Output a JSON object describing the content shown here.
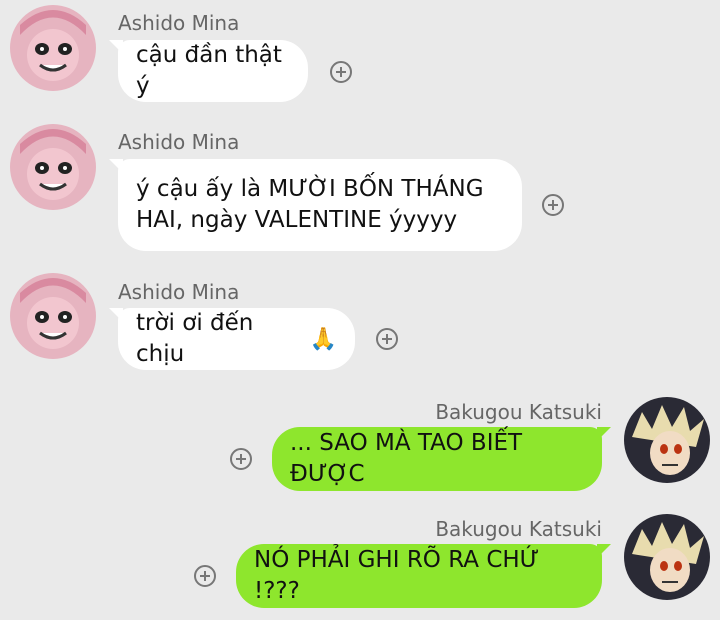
{
  "messages": [
    {
      "sender": "Ashido Mina",
      "text": "cậu đần thật ý",
      "direction": "incoming"
    },
    {
      "sender": "Ashido Mina",
      "text": "ý cậu ấy là MƯỜI BỐN THÁNG HAI, ngày VALENTINE ýyyyy",
      "direction": "incoming"
    },
    {
      "sender": "Ashido Mina",
      "text": "trời ơi đến chịu",
      "emoji": "🙏",
      "direction": "incoming"
    },
    {
      "sender": "Bakugou Katsuki",
      "text": "... SAO MÀ TAO BIẾT ĐƯỢC",
      "direction": "outgoing"
    },
    {
      "sender": "Bakugou Katsuki",
      "text": "NÓ PHẢI GHI RÕ RA CHỨ !???",
      "direction": "outgoing"
    }
  ],
  "colors": {
    "background": "#eaeaea",
    "incoming_bubble": "#ffffff",
    "outgoing_bubble": "#8ee62d"
  },
  "icons": {
    "reaction": "add-reaction-icon",
    "avatar_incoming": "ashido-mina-avatar",
    "avatar_outgoing": "bakugou-katsuki-avatar"
  }
}
